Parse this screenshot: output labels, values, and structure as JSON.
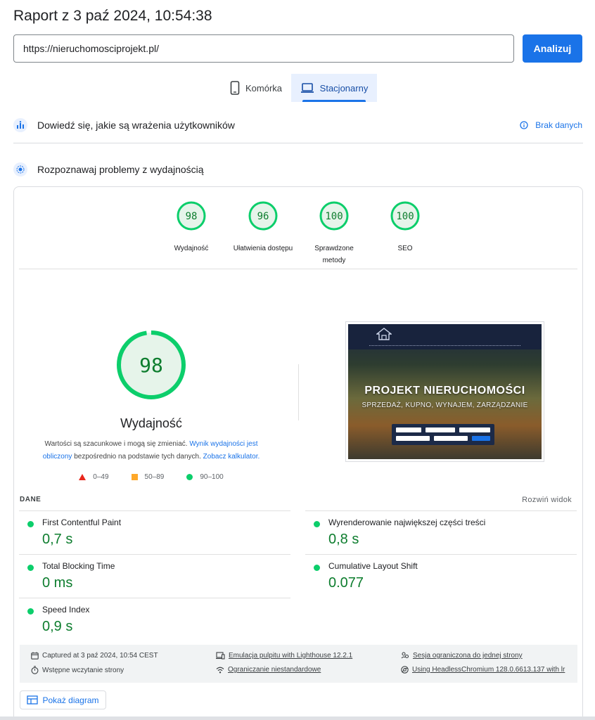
{
  "header": {
    "title": "Raport z 3 paź 2024, 10:54:38"
  },
  "search": {
    "url_value": "https://nieruchomosciprojekt.pl/",
    "analyze_label": "Analizuj"
  },
  "tabs": [
    {
      "label": "Komórka",
      "icon": "smartphone-icon",
      "selected": false
    },
    {
      "label": "Stacjonarny",
      "icon": "laptop-icon",
      "selected": true
    }
  ],
  "ux_section": {
    "title": "Dowiedź się, jakie są wrażenia użytkowników",
    "status": "Brak danych"
  },
  "perf_section": {
    "title": "Rozpoznawaj problemy z wydajnością"
  },
  "scores": [
    {
      "value": "98",
      "label": "Wydajność"
    },
    {
      "value": "96",
      "label": "Ułatwienia dostępu"
    },
    {
      "value": "100",
      "label": "Sprawdzone metody"
    },
    {
      "value": "100",
      "label": "SEO"
    }
  ],
  "main_score": {
    "value": "98",
    "label": "Wydajność",
    "desc_prefix": "Wartości są szacunkowe i mogą się zmieniać. ",
    "desc_link1": "Wynik wydajności jest obliczony",
    "desc_mid": " bezpośrednio na podstawie tych danych. ",
    "desc_link2": "Zobacz kalkulator."
  },
  "legend": [
    {
      "range": "0–49",
      "color": "#e8271c",
      "shape": "triangle"
    },
    {
      "range": "50–89",
      "color": "#fea829",
      "shape": "square"
    },
    {
      "range": "90–100",
      "color": "#0cce6b",
      "shape": "circle"
    }
  ],
  "page_screenshot": {
    "hero_title": "PROJEKT NIERUCHOMOŚCI",
    "hero_subtitle": "SPRZEDAŻ, KUPNO, WYNAJEM, ZARZĄDZANIE"
  },
  "metrics_section": {
    "title": "DANE",
    "expand_label": "Rozwiń widok"
  },
  "metrics": [
    {
      "name": "First Contentful Paint",
      "value": "0,7 s",
      "status_color": "#0cce6b"
    },
    {
      "name": "Wyrenderowanie największej części treści",
      "value": "0,8 s",
      "status_color": "#0cce6b"
    },
    {
      "name": "Total Blocking Time",
      "value": "0 ms",
      "status_color": "#0cce6b"
    },
    {
      "name": "Cumulative Layout Shift",
      "value": "0.077",
      "status_color": "#0cce6b"
    },
    {
      "name": "Speed Index",
      "value": "0,9 s",
      "status_color": "#0cce6b"
    }
  ],
  "run_info": {
    "captured": "Captured at 3 paź 2024, 10:54 CEST",
    "load": "Wstępne wczytanie strony",
    "emulation": "Emulacja pulpitu with Lighthouse 12.2.1",
    "throttling": "Ograniczanie niestandardowe",
    "session": "Sesja ograniczona do jednej strony",
    "browser": "Using HeadlessChromium 128.0.6613.137 with lr"
  },
  "diagram_button": {
    "label": "Pokaż diagram"
  },
  "colors": {
    "accent": "#1a73e8",
    "pass_green": "#0cce6b",
    "pass_text": "#0d7d2e",
    "gauge_fill": "#e6f4ea"
  }
}
